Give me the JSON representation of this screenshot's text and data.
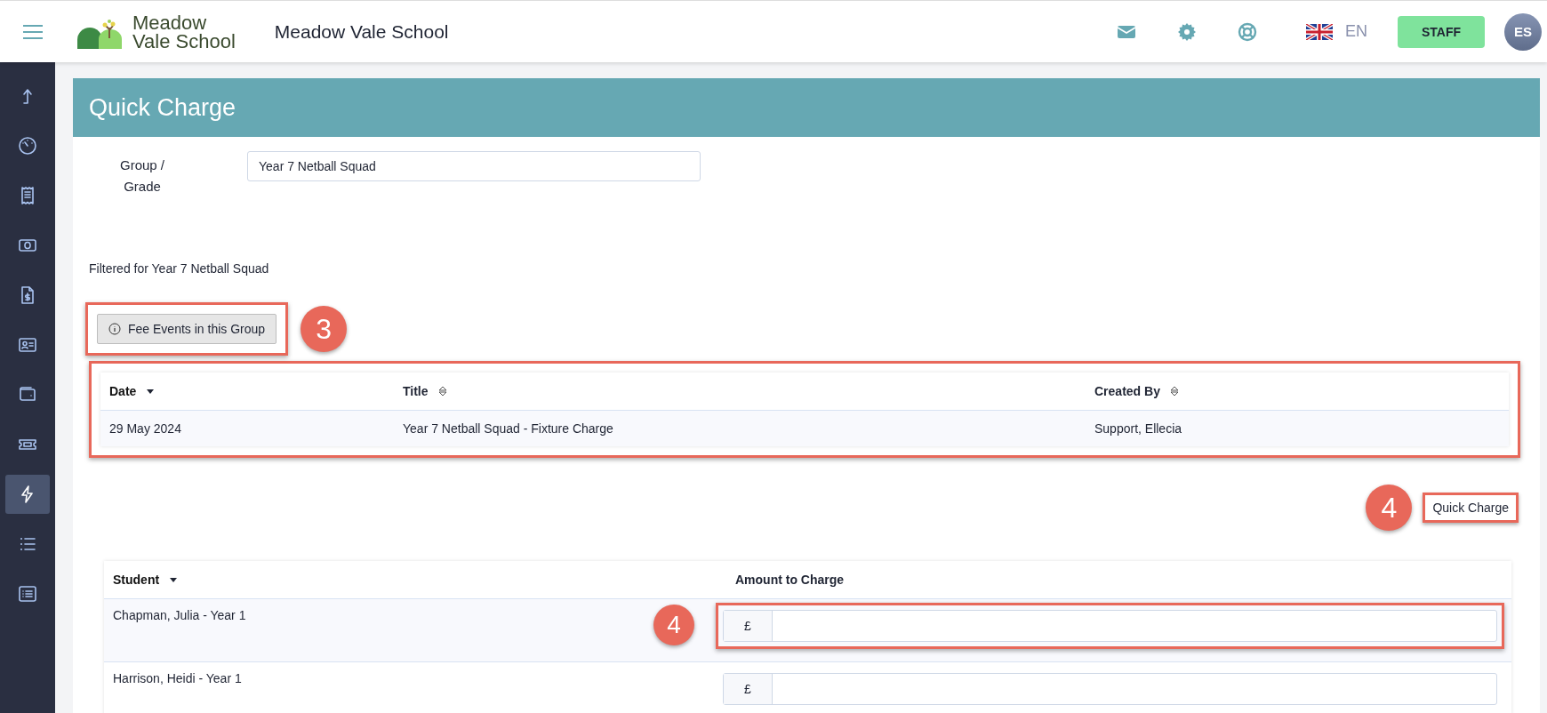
{
  "header": {
    "logo_lines": [
      "Meadow",
      "Vale School"
    ],
    "school_name": "Meadow Vale School",
    "language": "EN",
    "role_button": "STAFF",
    "avatar_initials": "ES"
  },
  "sidebar": {
    "items": [
      {
        "kind": "exit",
        "selected": false
      },
      {
        "kind": "gauge",
        "selected": false
      },
      {
        "kind": "receipt",
        "selected": false
      },
      {
        "kind": "cash",
        "selected": false
      },
      {
        "kind": "invoice",
        "selected": false
      },
      {
        "kind": "card",
        "selected": false
      },
      {
        "kind": "wallet",
        "selected": false
      },
      {
        "kind": "ticket",
        "selected": false
      },
      {
        "kind": "lightning",
        "selected": true
      },
      {
        "kind": "list",
        "selected": false
      },
      {
        "kind": "listbox",
        "selected": false
      }
    ]
  },
  "page": {
    "title": "Quick Charge",
    "group_field": {
      "label": "Group / Grade",
      "value": "Year 7 Netball Squad"
    },
    "filter_note": "Filtered for Year 7 Netball Squad",
    "fee_events_button": {
      "label": "Fee Events in this Group",
      "highlighted": true,
      "callout": "3"
    },
    "fee_events_table": {
      "highlighted": true,
      "columns": [
        {
          "label": "Date",
          "sortable": true,
          "sorted": true
        },
        {
          "label": "Title",
          "sortable": true,
          "sorted": false
        },
        {
          "label": "Created By",
          "sortable": true,
          "sorted": false
        }
      ],
      "rows": [
        [
          "29 May 2024",
          "Year 7 Netball Squad - Fixture Charge",
          "Support, Ellecia"
        ]
      ]
    },
    "quick_charge_button": {
      "label": "Quick Charge",
      "highlighted": true,
      "callout": "4"
    },
    "students_table": {
      "columns": [
        {
          "label": "Student",
          "sortable": true,
          "sorted": true
        },
        {
          "label": "Amount to Charge",
          "sortable": false,
          "sorted": false
        }
      ],
      "rows": [
        {
          "student": "Chapman, Julia - Year 1",
          "currency": "£",
          "highlighted": true,
          "callout": "4"
        },
        {
          "student": "Harrison, Heidi - Year 1",
          "currency": "£",
          "highlighted": false
        }
      ]
    }
  }
}
